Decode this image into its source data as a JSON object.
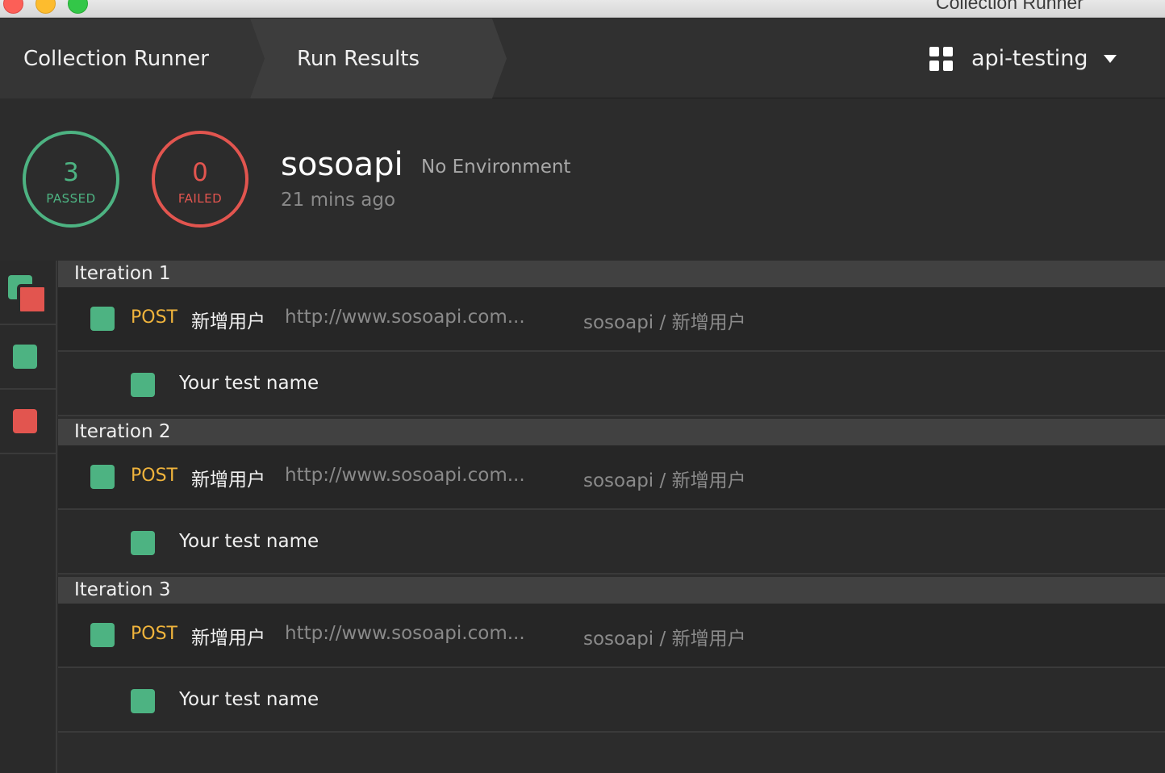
{
  "window": {
    "title": "Collection Runner"
  },
  "breadcrumb": {
    "item1": "Collection Runner",
    "item2": "Run Results"
  },
  "workspace": {
    "name": "api-testing"
  },
  "summary": {
    "passed_count": "3",
    "passed_label": "PASSED",
    "failed_count": "0",
    "failed_label": "FAILED",
    "collection": "sosoapi",
    "environment": "No Environment",
    "time": "21 mins ago"
  },
  "iterations": [
    {
      "label": "Iteration 1",
      "request": {
        "method": "POST",
        "name": "新增用户",
        "url": "http://www.sosoapi.com...",
        "path": "sosoapi / 新增用户"
      },
      "test": "Your test name"
    },
    {
      "label": "Iteration 2",
      "request": {
        "method": "POST",
        "name": "新增用户",
        "url": "http://www.sosoapi.com...",
        "path": "sosoapi / 新增用户"
      },
      "test": "Your test name"
    },
    {
      "label": "Iteration 3",
      "request": {
        "method": "POST",
        "name": "新增用户",
        "url": "http://www.sosoapi.com...",
        "path": "sosoapi / 新增用户"
      },
      "test": "Your test name"
    }
  ],
  "colors": {
    "pass": "#4db382",
    "fail": "#e2554f",
    "method": "#f0b43c",
    "background": "#2c2c2c"
  }
}
